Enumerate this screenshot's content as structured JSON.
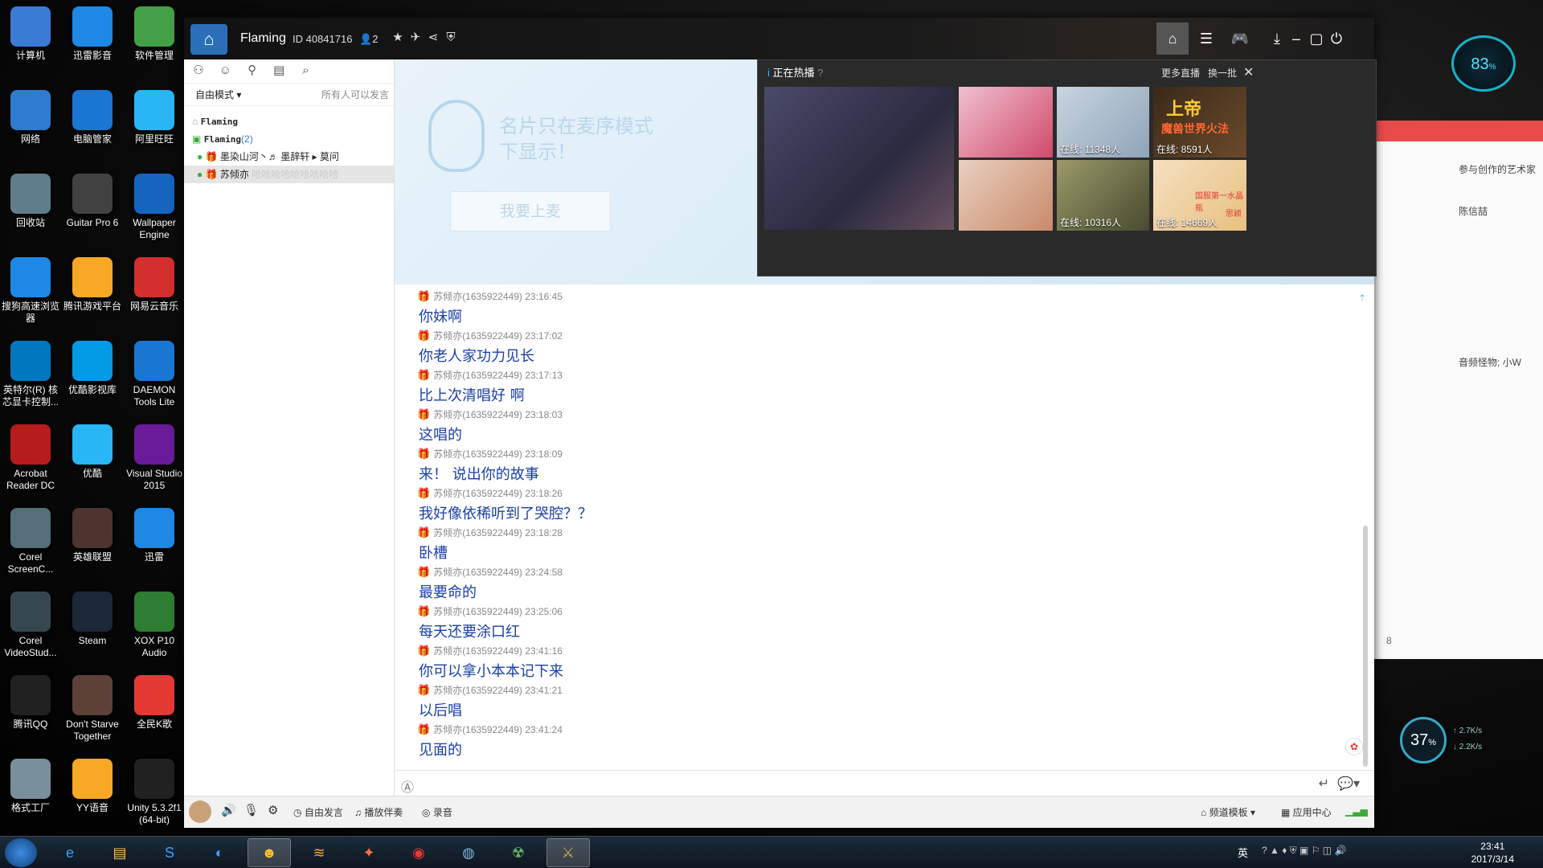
{
  "desktop_icons": [
    {
      "label": "计算机",
      "icon": "computer-icon",
      "color": "#3a7bd5"
    },
    {
      "label": "迅雷影音",
      "icon": "xunlei-player-icon",
      "color": "#1e88e5"
    },
    {
      "label": "软件管理",
      "icon": "software-manager-icon",
      "color": "#43a047"
    },
    {
      "label": "网络",
      "icon": "network-icon",
      "color": "#2e7bd0"
    },
    {
      "label": "电脑管家",
      "icon": "pc-manager-icon",
      "color": "#1976d2"
    },
    {
      "label": "阿里旺旺",
      "icon": "aliwangwang-icon",
      "color": "#29b6f6"
    },
    {
      "label": "回收站",
      "icon": "recycle-bin-icon",
      "color": "#607d8b"
    },
    {
      "label": "Guitar Pro 6",
      "icon": "guitar-pro-icon",
      "color": "#424242"
    },
    {
      "label": "Wallpaper Engine",
      "icon": "wallpaper-engine-icon",
      "color": "#1565c0"
    },
    {
      "label": "搜狗高速浏览器",
      "icon": "sogou-browser-icon",
      "color": "#1e88e5"
    },
    {
      "label": "腾讯游戏平台",
      "icon": "tencent-games-icon",
      "color": "#f9a825"
    },
    {
      "label": "网易云音乐",
      "icon": "netease-music-icon",
      "color": "#d32f2f"
    },
    {
      "label": "英特尔(R) 核芯显卡控制...",
      "icon": "intel-graphics-icon",
      "color": "#0277bd"
    },
    {
      "label": "优酷影视库",
      "icon": "youku-library-icon",
      "color": "#039be5"
    },
    {
      "label": "DAEMON Tools Lite",
      "icon": "daemon-tools-icon",
      "color": "#1976d2"
    },
    {
      "label": "Acrobat Reader DC",
      "icon": "acrobat-icon",
      "color": "#b71c1c"
    },
    {
      "label": "优酷",
      "icon": "youku-icon",
      "color": "#29b6f6"
    },
    {
      "label": "Visual Studio 2015",
      "icon": "visual-studio-icon",
      "color": "#6a1b9a"
    },
    {
      "label": "Corel ScreenC...",
      "icon": "corel-screencap-icon",
      "color": "#546e7a"
    },
    {
      "label": "英雄联盟",
      "icon": "league-of-legends-icon",
      "color": "#4e342e"
    },
    {
      "label": "迅雷",
      "icon": "xunlei-icon",
      "color": "#1e88e5"
    },
    {
      "label": "Corel VideoStud...",
      "icon": "corel-videostudio-icon",
      "color": "#37474f"
    },
    {
      "label": "Steam",
      "icon": "steam-icon",
      "color": "#1b2838"
    },
    {
      "label": "XOX P10 Audio",
      "icon": "xox-audio-icon",
      "color": "#2e7d32"
    },
    {
      "label": "腾讯QQ",
      "icon": "qq-icon",
      "color": "#212121"
    },
    {
      "label": "Don't Starve Together",
      "icon": "dont-starve-icon",
      "color": "#5d4037"
    },
    {
      "label": "全民K歌",
      "icon": "kge-icon",
      "color": "#e53935"
    },
    {
      "label": "格式工厂",
      "icon": "format-factory-icon",
      "color": "#78909c"
    },
    {
      "label": "YY语音",
      "icon": "yy-voice-icon",
      "color": "#f9a825"
    },
    {
      "label": "Unity 5.3.2f1 (64-bit)",
      "icon": "unity-icon",
      "color": "#212121"
    }
  ],
  "widgets": {
    "cpu_percent": "83",
    "cpu_unit": "%",
    "net_percent": "37",
    "net_unit": "%",
    "upload": "2.7K/s",
    "download": "2.2K/s"
  },
  "bg_window": {
    "line1": "参与创作的艺术家",
    "line2": "陈信喆",
    "line3": "音频怪物; 小W",
    "count": "8"
  },
  "yy": {
    "channel_name": "Flaming",
    "channel_id": "ID 40841716",
    "member_count": "2",
    "mode": "自由模式",
    "permission": "所有人可以发言",
    "tree": [
      {
        "label": "Flaming",
        "type": "root"
      },
      {
        "label": "Flaming",
        "count": "(2)",
        "type": "channel"
      },
      {
        "label": "墨染山河丶♬ 墨辞轩 ▸ 莫问",
        "type": "user"
      },
      {
        "label": "苏倾亦",
        "suffix": "哈哈哈哈哈哈哈哈哈",
        "type": "user-selected"
      }
    ],
    "promo_text": "名片只在麦序模式下显示！",
    "mic_button": "我要上麦",
    "hot": {
      "title": "正在热播",
      "more": "更多直播",
      "refresh": "换一批",
      "thumbs": [
        {
          "online": "",
          "color": "#3a3a5a"
        },
        {
          "online": "",
          "color": "#d04a6a"
        },
        {
          "online": "在线: 11348人",
          "color": "#8fa4b8"
        },
        {
          "online": "在线: 8591人",
          "color": "#6b4a2a"
        },
        {
          "online": "",
          "color": "#c98a6a"
        },
        {
          "online": "在线: 10316人",
          "color": "#6a6a40"
        },
        {
          "online": "在线: 14669人",
          "color": "#e8c080"
        }
      ],
      "thumb4_title": "上帝",
      "thumb4_sub": "魔兽世界火法",
      "thumb7_title": "国服第一水晶瓶",
      "thumb7_sub": "思颖"
    },
    "chat": [
      {
        "meta": "苏倾亦(1635922449) 23:16:45",
        "text": "你妹啊"
      },
      {
        "meta": "苏倾亦(1635922449) 23:17:02",
        "text": "你老人家功力见长"
      },
      {
        "meta": "苏倾亦(1635922449) 23:17:13",
        "text": "比上次清唱好 啊"
      },
      {
        "meta": "苏倾亦(1635922449) 23:18:03",
        "text": "这唱的"
      },
      {
        "meta": "苏倾亦(1635922449) 23:18:09",
        "text": "来！ 说出你的故事"
      },
      {
        "meta": "苏倾亦(1635922449) 23:18:26",
        "text": "我好像依稀听到了哭腔？？"
      },
      {
        "meta": "苏倾亦(1635922449) 23:18:28",
        "text": "卧槽"
      },
      {
        "meta": "苏倾亦(1635922449) 23:24:58",
        "text": "最要命的"
      },
      {
        "meta": "苏倾亦(1635922449) 23:25:06",
        "text": "每天还要涂口红"
      },
      {
        "meta": "苏倾亦(1635922449) 23:41:16",
        "text": "你可以拿小本本记下来"
      },
      {
        "meta": "苏倾亦(1635922449) 23:41:21",
        "text": "以后唱"
      },
      {
        "meta": "苏倾亦(1635922449) 23:41:24",
        "text": "见面的"
      }
    ],
    "bottom": {
      "free_speak": "自由发言",
      "play_accomp": "播放伴奏",
      "record": "录音",
      "template": "频道模板",
      "app_center": "应用中心"
    }
  },
  "taskbar": {
    "ime": "英",
    "time": "23:41",
    "date": "2017/3/14"
  }
}
